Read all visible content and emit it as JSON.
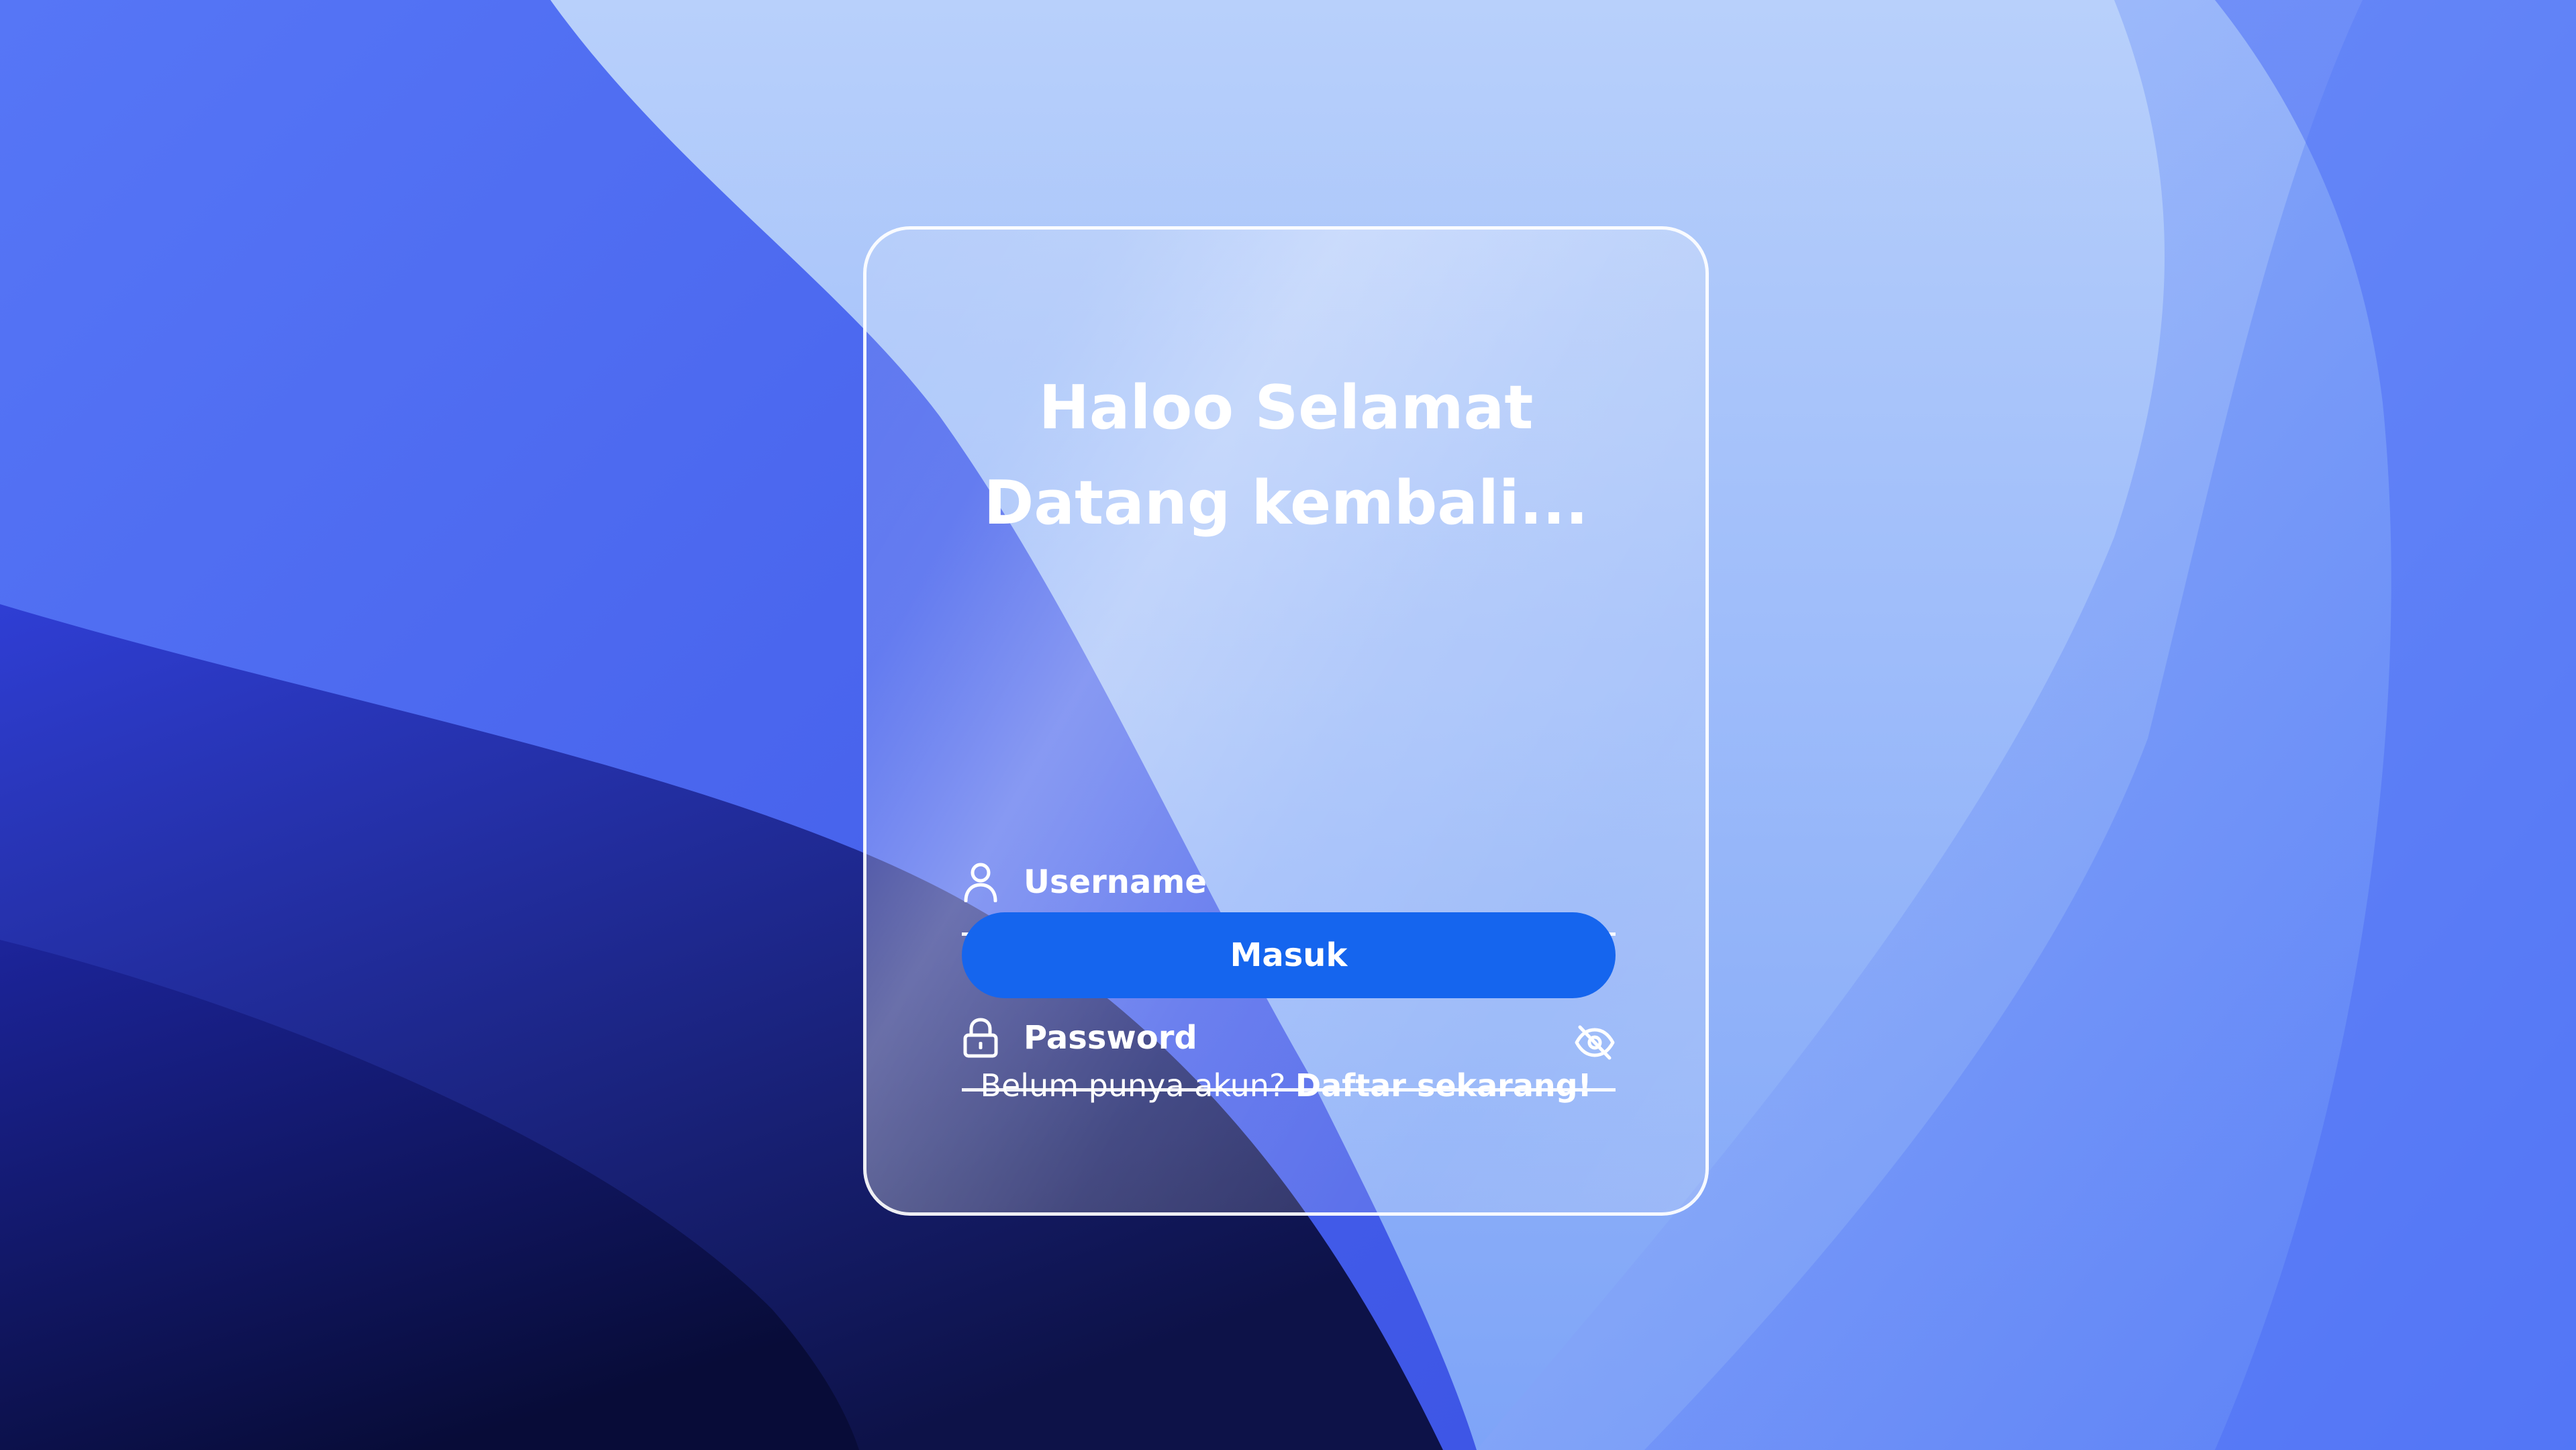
{
  "login": {
    "title_line1": "Haloo Selamat",
    "title_line2": "Datang kembali...",
    "username_placeholder": "Username",
    "password_placeholder": "Password",
    "submit_label": "Masuk",
    "register_prompt": "Belum punya akun?",
    "register_link": "Daftar sekarang!"
  },
  "icons": {
    "username": "user-icon",
    "password": "lock-icon",
    "visibility": "eye-off-icon"
  },
  "colors": {
    "button": "#1565ee",
    "text": "#ffffff",
    "background_primary": "#4a6cf7",
    "background_light": "#b8d0fb",
    "background_dark": "#0f1550"
  }
}
